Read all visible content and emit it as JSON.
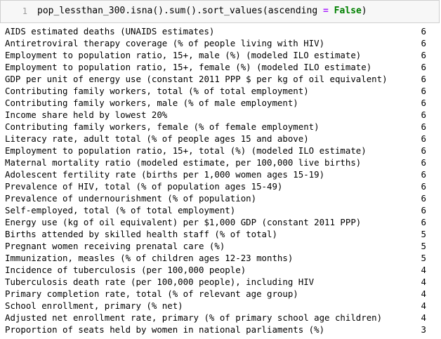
{
  "cell": {
    "line_number": "1",
    "code_prefix": "pop_lessthan_300.isna().sum().sort_values(ascending ",
    "code_operator": "=",
    "code_space": " ",
    "code_keyword": "False",
    "code_suffix": ")"
  },
  "output": {
    "rows": [
      {
        "label": "AIDS estimated deaths (UNAIDS estimates)",
        "count": "6"
      },
      {
        "label": "Antiretroviral therapy coverage (% of people living with HIV)",
        "count": "6"
      },
      {
        "label": "Employment to population ratio, 15+, male (%) (modeled ILO estimate)",
        "count": "6"
      },
      {
        "label": "Employment to population ratio, 15+, female (%) (modeled ILO estimate)",
        "count": "6"
      },
      {
        "label": "GDP per unit of energy use (constant 2011 PPP $ per kg of oil equivalent)",
        "count": "6"
      },
      {
        "label": "Contributing family workers, total (% of total employment)",
        "count": "6"
      },
      {
        "label": "Contributing family workers, male (% of male employment)",
        "count": "6"
      },
      {
        "label": "Income share held by lowest 20%",
        "count": "6"
      },
      {
        "label": "Contributing family workers, female (% of female employment)",
        "count": "6"
      },
      {
        "label": "Literacy rate, adult total (% of people ages 15 and above)",
        "count": "6"
      },
      {
        "label": "Employment to population ratio, 15+, total (%) (modeled ILO estimate)",
        "count": "6"
      },
      {
        "label": "Maternal mortality ratio (modeled estimate, per 100,000 live births)",
        "count": "6"
      },
      {
        "label": "Adolescent fertility rate (births per 1,000 women ages 15-19)",
        "count": "6"
      },
      {
        "label": "Prevalence of HIV, total (% of population ages 15-49)",
        "count": "6"
      },
      {
        "label": "Prevalence of undernourishment (% of population)",
        "count": "6"
      },
      {
        "label": "Self-employed, total (% of total employment)",
        "count": "6"
      },
      {
        "label": "Energy use (kg of oil equivalent) per $1,000 GDP (constant 2011 PPP)",
        "count": "6"
      },
      {
        "label": "Births attended by skilled health staff (% of total)",
        "count": "5"
      },
      {
        "label": "Pregnant women receiving prenatal care (%)",
        "count": "5"
      },
      {
        "label": "Immunization, measles (% of children ages 12-23 months)",
        "count": "5"
      },
      {
        "label": "Incidence of tuberculosis (per 100,000 people)",
        "count": "4"
      },
      {
        "label": "Tuberculosis death rate (per 100,000 people), including HIV",
        "count": "4"
      },
      {
        "label": "Primary completion rate, total (% of relevant age group)",
        "count": "4"
      },
      {
        "label": "School enrollment, primary (% net)",
        "count": "4"
      },
      {
        "label": "Adjusted net enrollment rate, primary (% of primary school age children)",
        "count": "4"
      },
      {
        "label": "Proportion of seats held by women in national parliaments (%)",
        "count": "3"
      }
    ]
  }
}
